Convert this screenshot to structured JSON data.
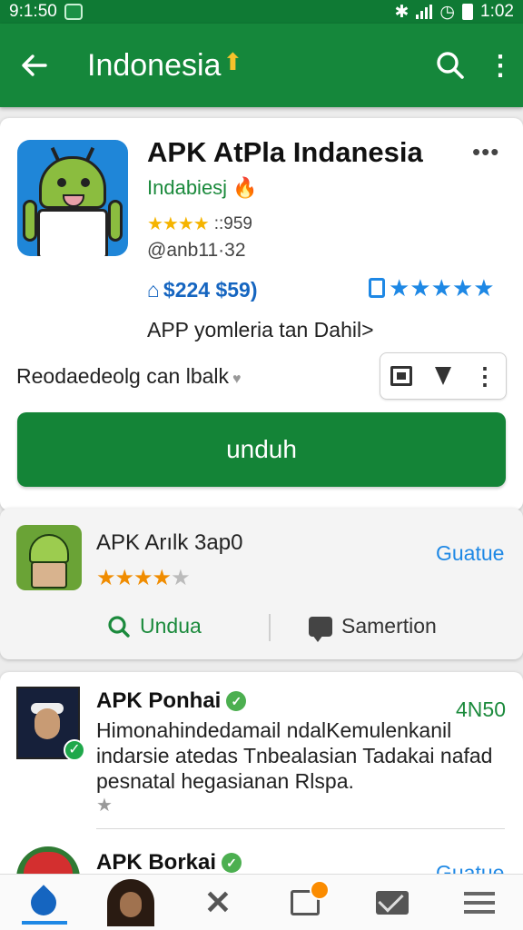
{
  "status_bar": {
    "time_left": "9:1:50",
    "time_right": "1:02"
  },
  "app_bar": {
    "title": "Indonesia",
    "title_arrow": "⬆",
    "back_icon": "arrow-left-icon",
    "search_icon": "search-icon",
    "more_icon": "more-vert-icon"
  },
  "hero": {
    "app_name": "APK AtPla Indanesia",
    "developer": "Indabiesj",
    "rating_stars": "★★★★",
    "rating_count": "::959",
    "handle": "@anb11·32",
    "price": "$224 $59)",
    "top_stars": "★★★★★",
    "tagline": "APP yomleria tan Dahil>",
    "recommend": "Reodaedeolg can lbalk",
    "install_label": "unduh"
  },
  "related": {
    "name": "APK Arılk 3ap0",
    "stars_filled": "★★★★",
    "stars_empty": "★",
    "install_label": "Guatue",
    "download_label": "Undua",
    "comment_label": "Samertion"
  },
  "list": {
    "item1": {
      "name": "APK Ponhai",
      "count": "4N50",
      "desc": "Himonahindedamail ndalKemulenkanil indarsie atedas Tnbealasian Tadakai nafad pesnatal hegasianan Rlspa."
    },
    "item2": {
      "name": "APK Borkai",
      "install_label": "Guatue"
    }
  },
  "colors": {
    "brand_green": "#15873b",
    "accent_blue": "#1e88e5",
    "star_yellow": "#f5b400"
  }
}
